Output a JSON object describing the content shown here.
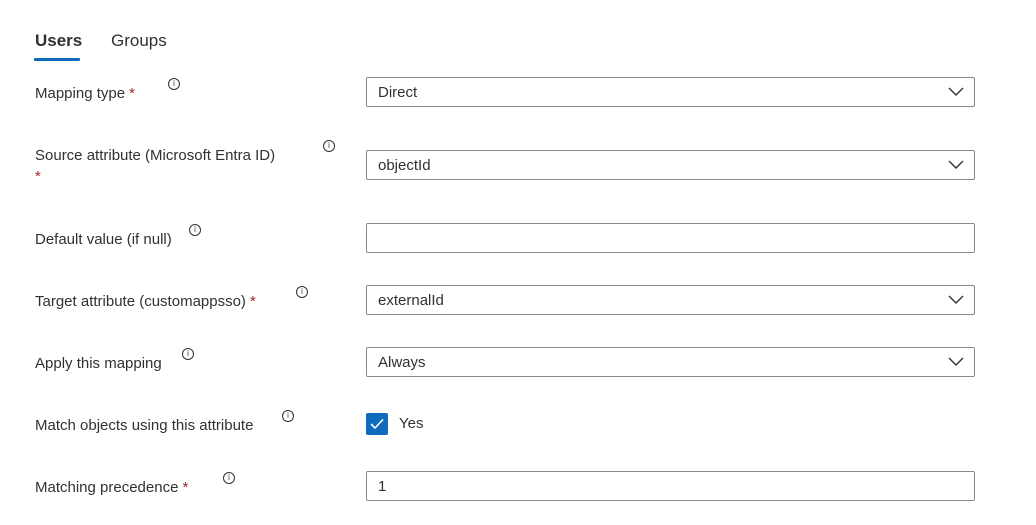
{
  "tabs": [
    {
      "label": "Users",
      "active": true
    },
    {
      "label": "Groups",
      "active": false
    }
  ],
  "rows": {
    "mapping_type": {
      "label": "Mapping type",
      "required": "*",
      "value": "Direct"
    },
    "source_attribute": {
      "label": "Source attribute (Microsoft Entra ID)",
      "required": "*",
      "value": "objectId"
    },
    "default_value": {
      "label": "Default value (if null)",
      "value": ""
    },
    "target_attribute": {
      "label": "Target attribute (customappsso)",
      "required": "*",
      "value": "externalId"
    },
    "apply_mapping": {
      "label": "Apply this mapping",
      "value": "Always"
    },
    "match_objects": {
      "label": "Match objects using this attribute",
      "checked": true,
      "check_label": "Yes"
    },
    "matching_precedence": {
      "label": "Matching precedence",
      "required": "*",
      "value": "1"
    }
  },
  "info_glyph": "i",
  "icons": {
    "info": "info-circle-icon",
    "chevron": "chevron-down-icon",
    "check": "checkmark-icon"
  },
  "colors": {
    "accent": "#0f6cbd",
    "required": "#a4262c",
    "border": "#8a8886"
  }
}
